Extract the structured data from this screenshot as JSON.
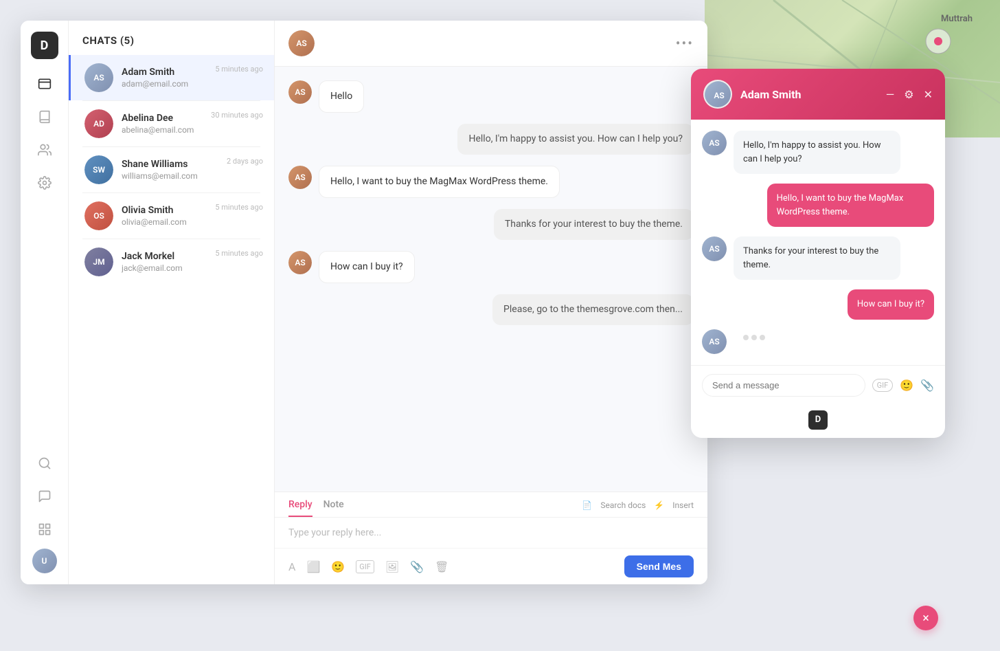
{
  "app": {
    "logo": "D",
    "nav_icons": [
      "inbox",
      "book",
      "users",
      "settings",
      "search",
      "chat",
      "grid",
      "user"
    ]
  },
  "chat_list": {
    "header": "CHATS (5)",
    "items": [
      {
        "id": 1,
        "name": "Adam Smith",
        "email": "adam@email.com",
        "time": "5 minutes ago",
        "active": true
      },
      {
        "id": 2,
        "name": "Abelina Dee",
        "email": "abelina@email.com",
        "time": "30 minutes ago",
        "active": false
      },
      {
        "id": 3,
        "name": "Shane Williams",
        "email": "williams@email.com",
        "time": "2 days ago",
        "active": false
      },
      {
        "id": 4,
        "name": "Olivia Smith",
        "email": "olivia@email.com",
        "time": "5 minutes ago",
        "active": false
      },
      {
        "id": 5,
        "name": "Jack Morkel",
        "email": "jack@email.com",
        "time": "5 minutes ago",
        "active": false
      }
    ]
  },
  "main_chat": {
    "more_icon": "•••",
    "messages": [
      {
        "type": "sent",
        "text": "Hello",
        "id": "m1"
      },
      {
        "type": "received",
        "text": "Hello, I'm happy to assist you. How can I help you?",
        "id": "m2"
      },
      {
        "type": "sent",
        "text": "Hello, I want to buy the MagMax WordPress theme.",
        "id": "m3"
      },
      {
        "type": "received",
        "text": "Thanks for your interest to buy the theme.",
        "id": "m4"
      },
      {
        "type": "sent",
        "text": "How can I buy it?",
        "id": "m5"
      },
      {
        "type": "received",
        "text": "Please, go to the themesgrove.com then...",
        "id": "m6"
      }
    ],
    "reply_tab": "Reply",
    "note_tab": "Note",
    "search_docs": "Search docs",
    "insert_label": "Insert",
    "placeholder": "Type your reply here...",
    "send_button": "Send Mes"
  },
  "float_panel": {
    "name": "Adam Smith",
    "messages": [
      {
        "type": "received",
        "text": "Hello, I'm happy to assist you. How can I help you?",
        "id": "f1"
      },
      {
        "type": "sent",
        "text": "Hello, I want to buy the MagMax WordPress theme.",
        "id": "f2"
      },
      {
        "type": "received",
        "text": "Thanks for your interest to buy the theme.",
        "id": "f3"
      },
      {
        "type": "sent",
        "text": "How can I buy it?",
        "id": "f4"
      },
      {
        "type": "typing",
        "id": "f5"
      }
    ],
    "input_placeholder": "Send a message",
    "gif_btn": "GIF",
    "logo": "D"
  },
  "map": {
    "label": "Muttrah"
  },
  "close_btn": "×"
}
